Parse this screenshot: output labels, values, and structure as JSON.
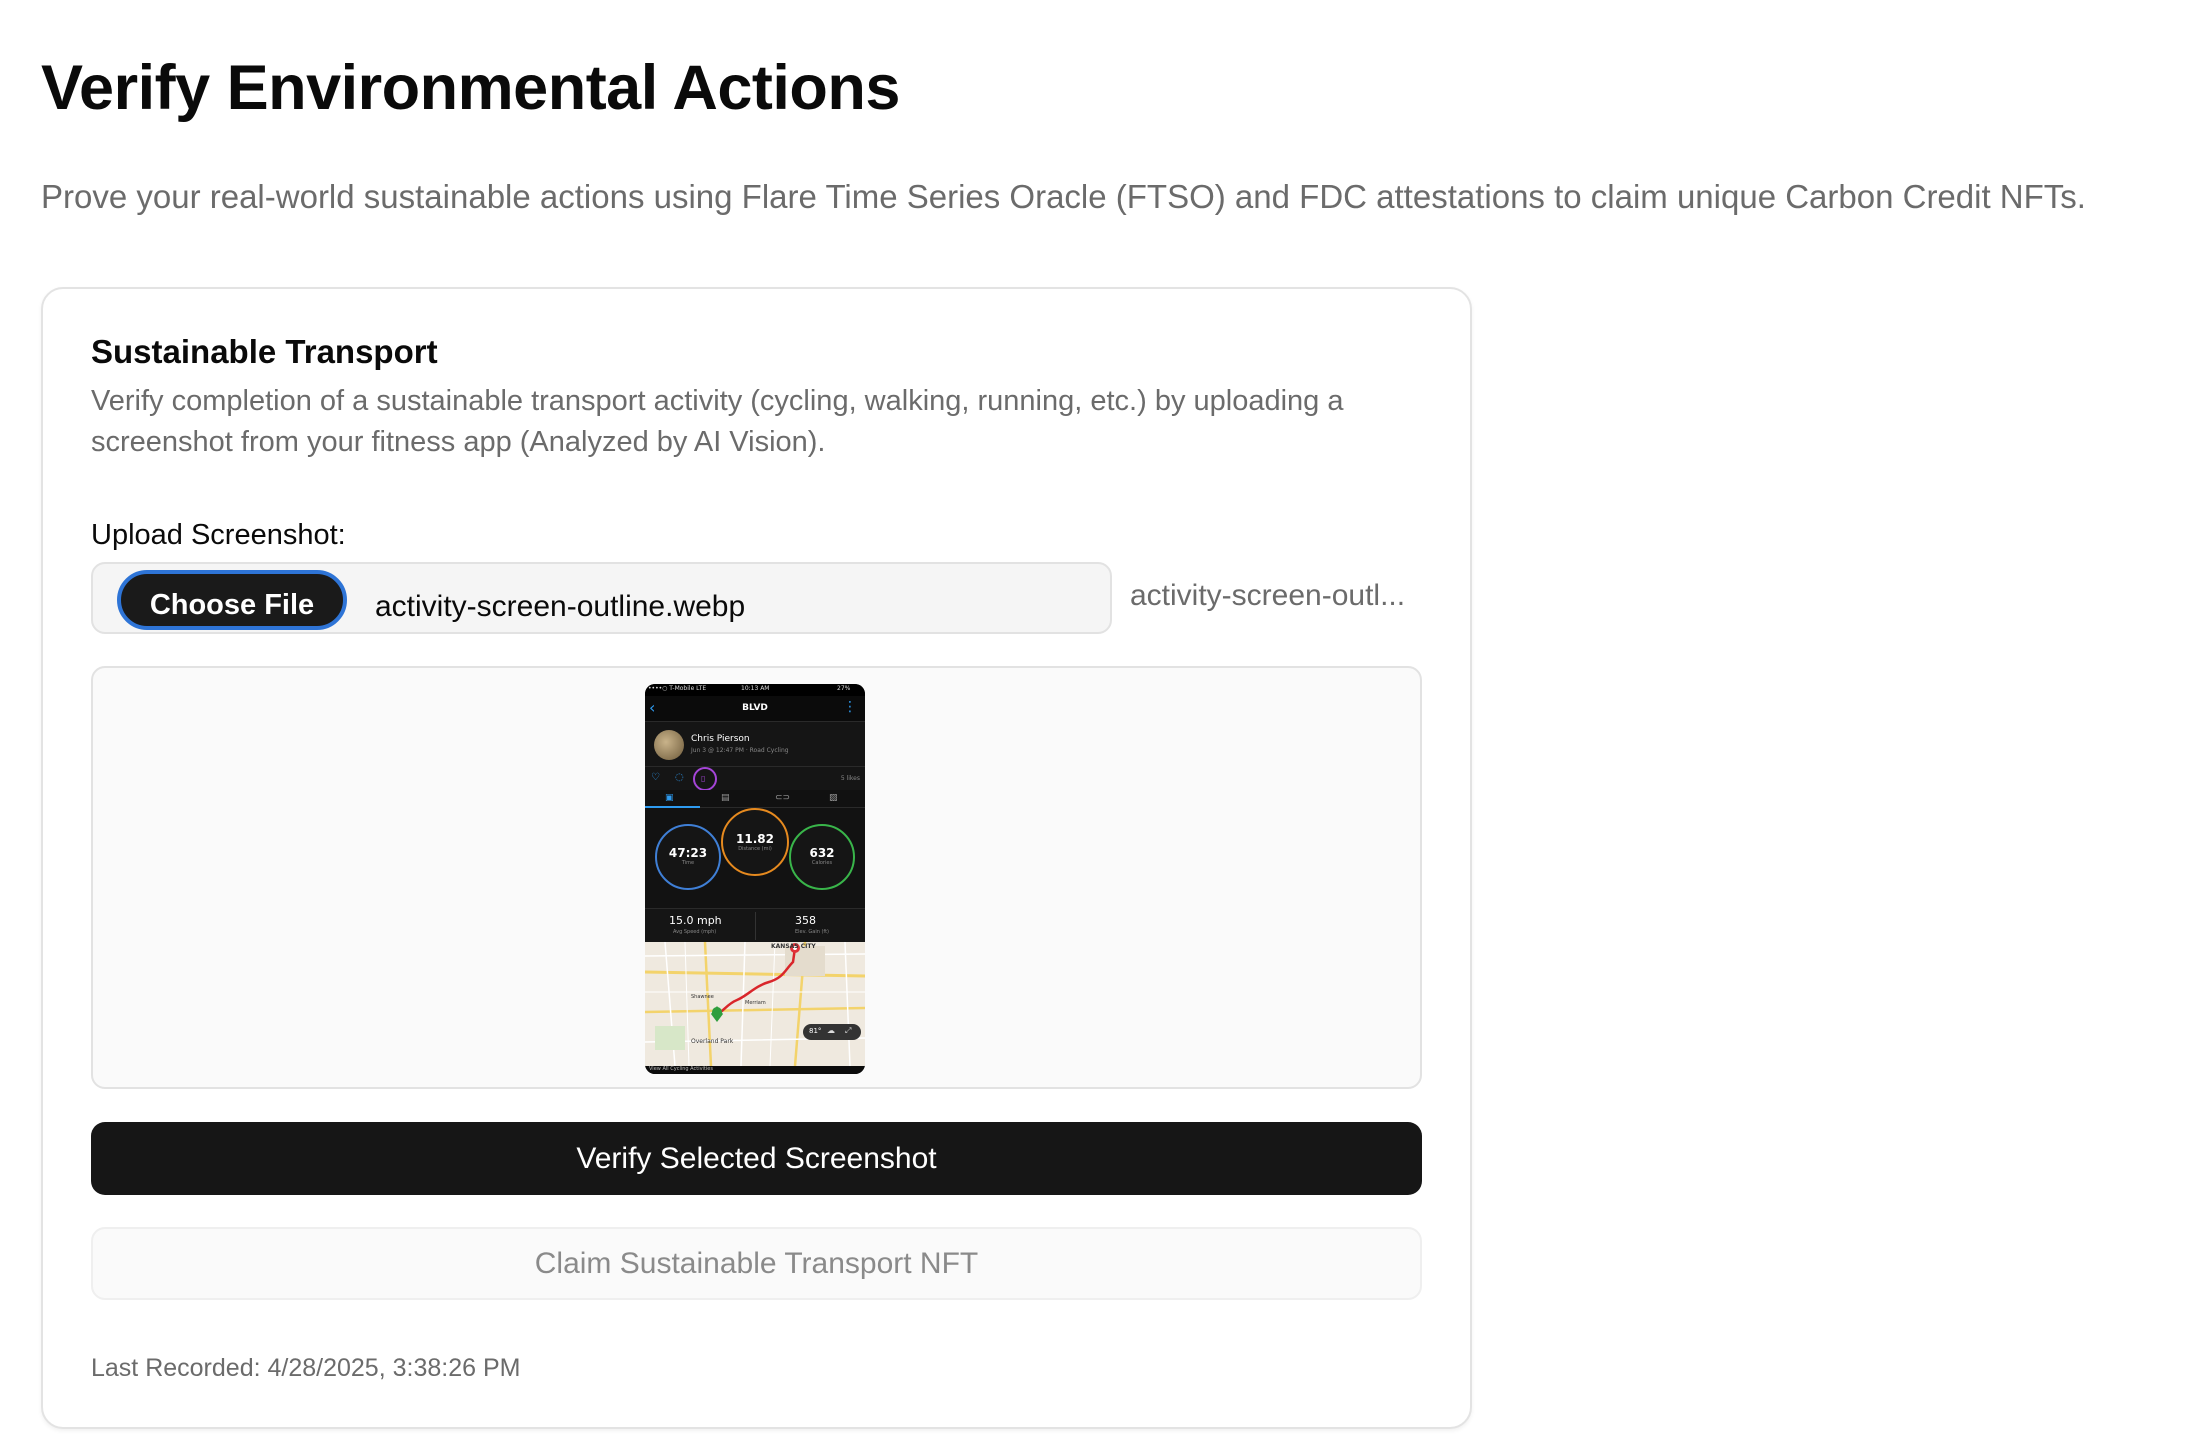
{
  "page": {
    "title": "Verify Environmental Actions",
    "subtitle": "Prove your real-world sustainable actions using Flare Time Series Oracle (FTSO) and FDC attestations to claim unique Carbon Credit NFTs."
  },
  "card": {
    "title": "Sustainable Transport",
    "description": "Verify completion of a sustainable transport activity (cycling, walking, running, etc.) by uploading a screenshot from your fitness app (Analyzed by AI Vision).",
    "upload_label": "Upload Screenshot:",
    "file_input": {
      "button_label": "Choose File",
      "file_name": "activity-screen-outline.webp",
      "file_name_truncated": "activity-screen-outl..."
    },
    "preview": {
      "status_bar": {
        "carrier": "••••○ T-Mobile  LTE",
        "time": "10:13 AM",
        "battery": "27%"
      },
      "nav_title": "BLVD",
      "user_name": "Chris Pierson",
      "activity_meta": "Jun 3 @ 12:47 PM · Road Cycling",
      "likes": "5 likes",
      "stats": [
        {
          "value": "47:23",
          "label": "Time"
        },
        {
          "value": "11.82",
          "label": "Distance (mi)"
        },
        {
          "value": "632",
          "label": "Calories"
        }
      ],
      "metrics": [
        {
          "value": "15.0 mph",
          "label": "Avg Speed (mph)"
        },
        {
          "value": "358",
          "label": "Elev. Gain (ft)"
        }
      ],
      "map_labels": {
        "city": "KANSAS CITY",
        "shawnee": "Shawnee",
        "overland": "Overland Park",
        "merriam": "Merriam",
        "temp": "81°"
      },
      "footer": "View All Cycling Activities"
    },
    "verify_button": "Verify Selected Screenshot",
    "claim_button": "Claim Sustainable Transport NFT",
    "last_recorded": "Last Recorded: 4/28/2025, 3:38:26 PM"
  },
  "colors": {
    "primary_button": "#161616",
    "focus_ring": "#2e74d6",
    "muted_text": "#6b6b6b"
  }
}
